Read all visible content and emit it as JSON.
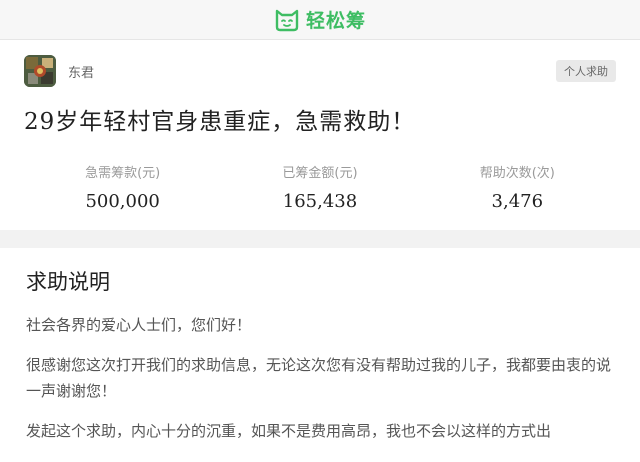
{
  "header": {
    "brand": "轻松筹",
    "logo_icon": "cat-face-icon",
    "brand_color": "#3ebd63"
  },
  "user": {
    "name": "东君",
    "badge": "个人求助"
  },
  "campaign": {
    "title": "29岁年轻村官身患重症，急需救助！"
  },
  "stats": [
    {
      "label": "急需筹款(元)",
      "value": "500,000"
    },
    {
      "label": "已筹金额(元)",
      "value": "165,438"
    },
    {
      "label": "帮助次数(次)",
      "value": "3,476"
    }
  ],
  "description": {
    "heading": "求助说明",
    "paragraphs": [
      "社会各界的爱心人士们，您们好！",
      "很感谢您这次打开我们的求助信息，无论这次您有没有帮助过我的儿子，我都要由衷的说一声谢谢您！",
      "发起这个求助，内心十分的沉重，如果不是费用高昂，我也不会以这样的方式出"
    ]
  }
}
